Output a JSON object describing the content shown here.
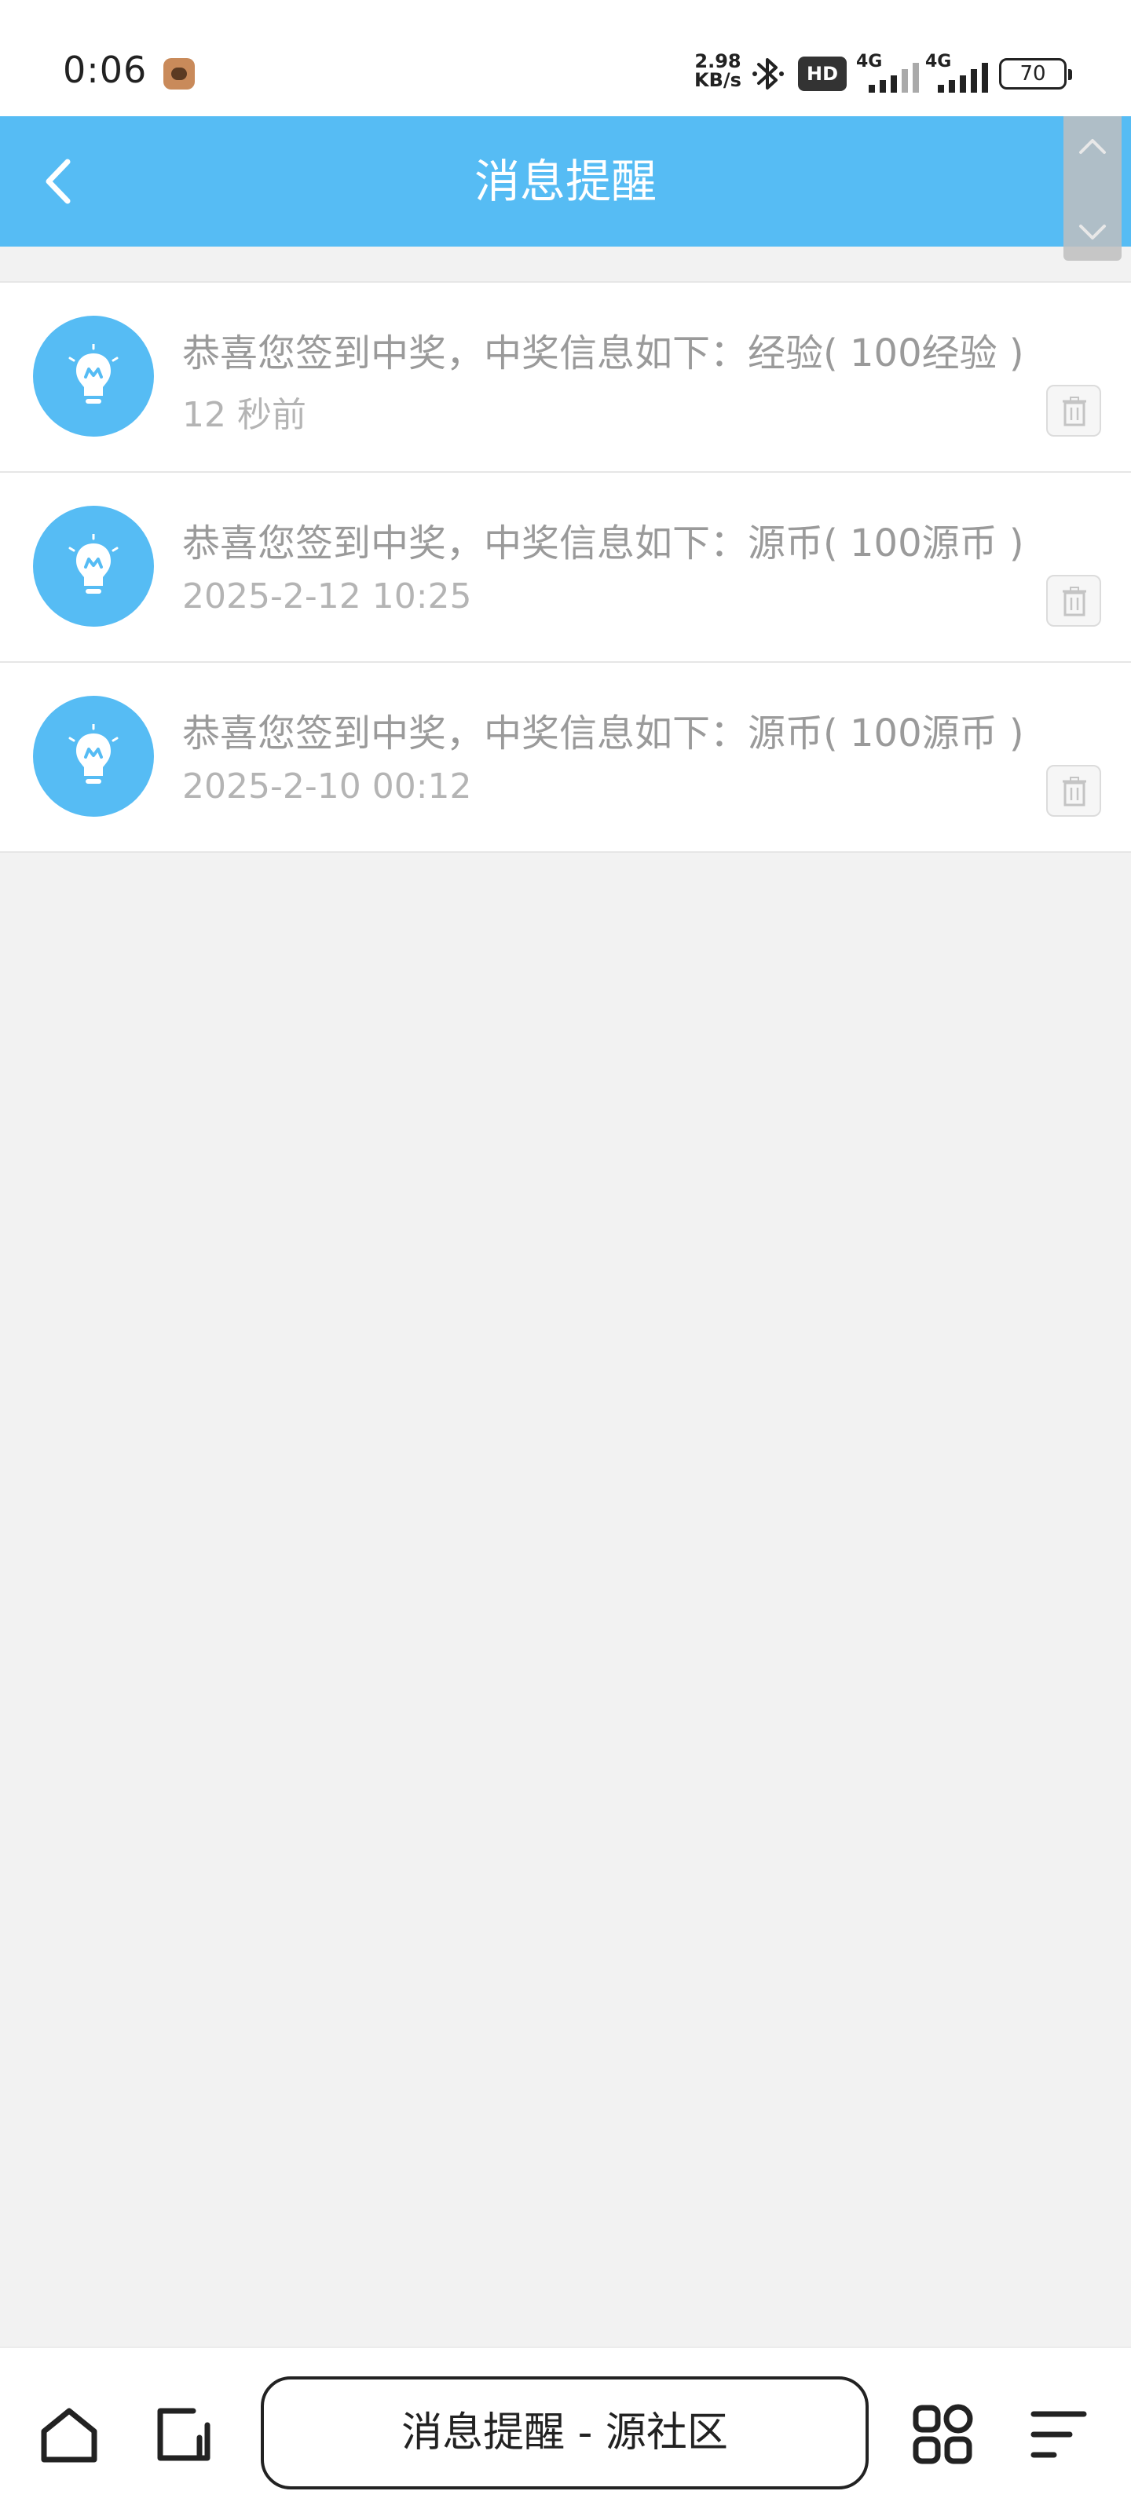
{
  "status_bar": {
    "time": "0:06",
    "net_speed_value": "2.98",
    "net_speed_unit": "KB/s",
    "hd_label": "HD",
    "signal1_label": "4G",
    "signal2_label": "4G",
    "battery": "70"
  },
  "header": {
    "title": "消息提醒"
  },
  "messages": [
    {
      "text": "恭喜您签到中奖，中奖信息如下：经验( 100经验 )",
      "time": "12 秒前"
    },
    {
      "text": "恭喜您签到中奖，中奖信息如下：源币( 100源币 )",
      "time": "2025-2-12 10:25"
    },
    {
      "text": "恭喜您签到中奖，中奖信息如下：源币( 100源币 )",
      "time": "2025-2-10 00:12"
    }
  ],
  "bottom_bar": {
    "address": "消息提醒 - 源社区"
  },
  "colors": {
    "accent": "#56bcf4",
    "text_muted": "#9a9a9a"
  }
}
